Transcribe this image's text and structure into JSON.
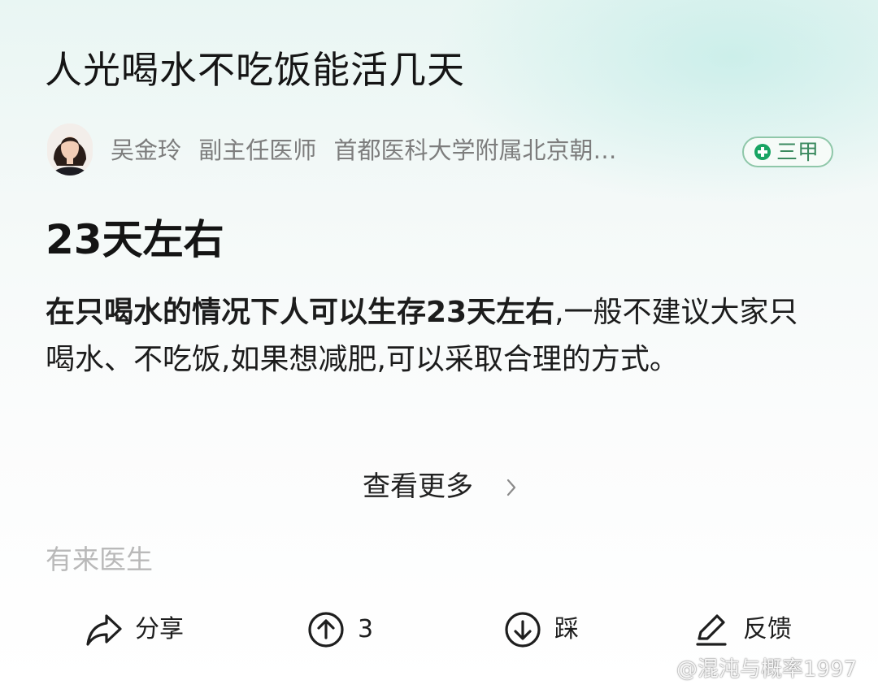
{
  "question": {
    "title": "人光喝水不吃饭能活几天"
  },
  "author": {
    "name": "吴金玲",
    "position": "副主任医师",
    "hospital": "首都医科大学附属北京朝…",
    "badge": "三甲"
  },
  "answer": {
    "headline": "23天左右",
    "body_bold": "在只喝水的情况下人可以生存23天左右",
    "body_rest": ",一般不建议大家只喝水、不吃饭,如果想减肥,可以采取合理的方式。",
    "more_label": "查看更多",
    "source": "有来医生"
  },
  "actions": {
    "share": "分享",
    "upvote_count": "3",
    "downvote": "踩",
    "feedback": "反馈"
  },
  "watermark": {
    "text": "@混沌与概率1997",
    "icon": "weibo-icon"
  },
  "colors": {
    "badge_green": "#19a463",
    "badge_border": "#8fc7a9",
    "muted_text": "#7d7d7d",
    "source_text": "#b9b9b9"
  }
}
